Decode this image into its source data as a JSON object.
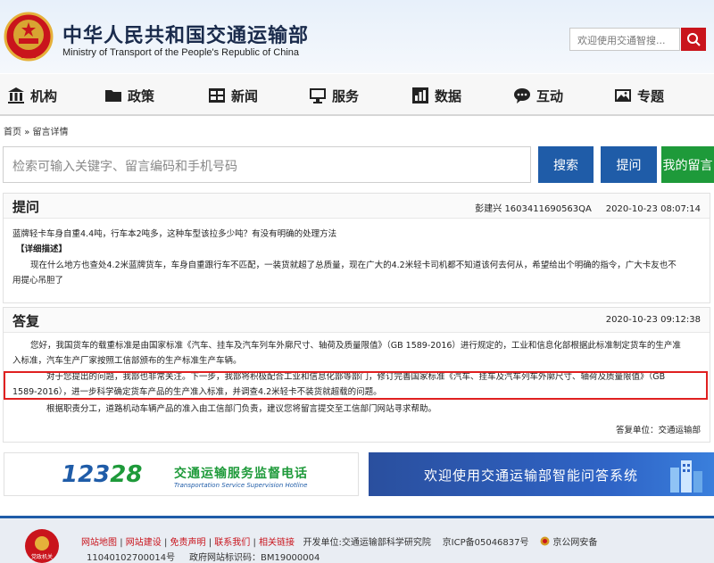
{
  "header": {
    "title": "中华人民共和国交通运输部",
    "subtitle": "Ministry of Transport of the People's Republic of China",
    "search_placeholder": "欢迎使用交通智搜..."
  },
  "nav": [
    {
      "label": "机构",
      "icon": "building-icon"
    },
    {
      "label": "政策",
      "icon": "folder-icon"
    },
    {
      "label": "新闻",
      "icon": "news-grid-icon"
    },
    {
      "label": "服务",
      "icon": "monitor-icon"
    },
    {
      "label": "数据",
      "icon": "bar-chart-icon"
    },
    {
      "label": "互动",
      "icon": "chat-icon"
    },
    {
      "label": "专题",
      "icon": "picture-icon"
    }
  ],
  "breadcrumb": {
    "home": "首页",
    "sep": "»",
    "current": "留言详情"
  },
  "search": {
    "placeholder": "检索可输入关键字、留言编码和手机号码",
    "search_label": "搜索",
    "ask_label": "提问",
    "mine_label": "我的留言"
  },
  "question": {
    "heading": "提问",
    "author_code": "彭建兴 1603411690563QA",
    "datetime": "2020-10-23 08:07:14",
    "summary": "蓝牌轻卡车身自重4.4吨，行车本2吨多，这种车型该拉多少吨？有没有明确的处理方法",
    "detail_label": "【详细描述】",
    "detail_line1": "现在什么地方也查处4.2米蓝牌货车，车身自重跟行车不匹配，一装货就超了总质量，现在广大的4.2米轻卡司机都不知道该何去何从，希望给出个明确的指令，广大卡友也不",
    "detail_line2": "用提心吊胆了"
  },
  "answer": {
    "heading": "答复",
    "datetime": "2020-10-23 09:12:38",
    "p1_line1": "您好，我国货车的载重标准是由国家标准《汽车、挂车及汽车列车外廓尺寸、轴荷及质量限值》（GB 1589-2016）进行规定的，工业和信息化部根据此标准制定货车的生产准",
    "p1_line2": "入标准，汽车生产厂家按照工信部颁布的生产标准生产车辆。",
    "p2_line1": "对于您提出的问题，我部也非常关注。下一步，我部将积极配合工业和信息化部等部门，修订完善国家标准《汽车、挂车及汽车列车外廓尺寸、轴荷及质量限值》（GB",
    "p2_line2": "1589-2016），进一步科学确定货车产品的生产准入标准，并调查4.2米轻卡不装货就超载的问题。",
    "p3": "根据职责分工，道路机动车辆产品的准入由工信部门负责，建议您将留言提交至工信部门网站寻求帮助。",
    "unit": "答复单位：交通运输部"
  },
  "banners": {
    "hotline_number_a": "123",
    "hotline_number_b": "28",
    "hotline_cn": "交通运输服务监督电话",
    "hotline_en": "Transportation Service Supervision Hotline",
    "qa_text": "欢迎使用交通运输部智能问答系统"
  },
  "footer": {
    "links": [
      "网站地图",
      "网站建设",
      "免责声明",
      "联系我们",
      "相关链接"
    ],
    "sep": "|",
    "developer": "开发单位:交通运输部科学研究院",
    "icp": "京ICP备05046837号",
    "police": "京公网安备",
    "police_code": "11040102700014号",
    "site_code": "政府网站标识码：BM19000004",
    "badge_text": "党政机关"
  },
  "colors": {
    "brand_red": "#c9141c",
    "brand_blue": "#1f5ca8",
    "brand_green": "#1e9a3a"
  }
}
